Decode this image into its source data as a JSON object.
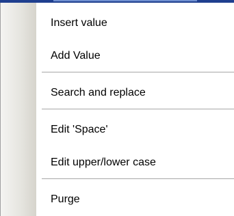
{
  "context_menu": {
    "items": [
      {
        "label": "Insert value"
      },
      {
        "label": "Add Value"
      },
      {
        "label": "Search and replace"
      },
      {
        "label": "Edit 'Space'"
      },
      {
        "label": "Edit upper/lower case"
      },
      {
        "label": "Purge"
      }
    ]
  }
}
